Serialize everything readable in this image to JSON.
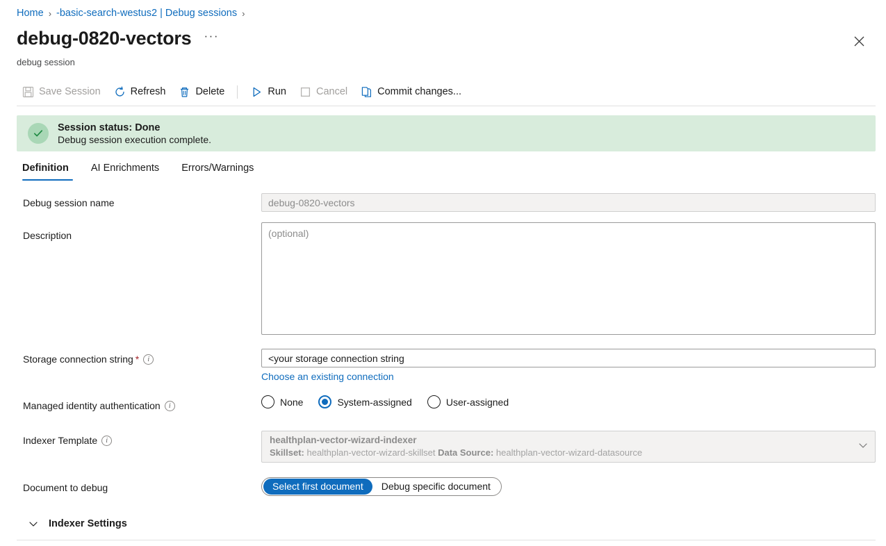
{
  "breadcrumb": {
    "items": [
      {
        "label": "Home"
      },
      {
        "label": "-basic-search-westus2 | Debug sessions"
      }
    ],
    "separator": "›"
  },
  "header": {
    "title": "debug-0820-vectors",
    "ellipsis": "···",
    "subtitle": "debug session",
    "close_icon": "close-icon"
  },
  "toolbar": {
    "items": [
      {
        "label": "Save Session",
        "icon": "save-icon",
        "disabled": true
      },
      {
        "label": "Refresh",
        "icon": "refresh-icon",
        "disabled": false
      },
      {
        "label": "Delete",
        "icon": "trash-icon",
        "disabled": false
      },
      {
        "label": "Run",
        "icon": "play-icon",
        "disabled": false
      },
      {
        "label": "Cancel",
        "icon": "stop-icon",
        "disabled": true
      },
      {
        "label": "Commit changes...",
        "icon": "copy-icon",
        "disabled": false
      }
    ]
  },
  "banner": {
    "title": "Session status: Done",
    "message": "Debug session execution complete.",
    "icon": "check-circle-icon",
    "background": "#d8ecdc",
    "icon_background": "#a9d7b6",
    "check_color": "#1f8a43"
  },
  "tabs": [
    {
      "label": "Definition",
      "active": true
    },
    {
      "label": "AI Enrichments",
      "active": false
    },
    {
      "label": "Errors/Warnings",
      "active": false
    }
  ],
  "form": {
    "session_name": {
      "label": "Debug session name",
      "value": "debug-0820-vectors",
      "disabled": true
    },
    "description": {
      "label": "Description",
      "value": "",
      "placeholder": "(optional)"
    },
    "storage_connection": {
      "label": "Storage connection string",
      "required_marker": "*",
      "value": "<your storage connection string",
      "link": "Choose an existing connection"
    },
    "managed_identity": {
      "label": "Managed identity authentication",
      "options": [
        {
          "label": "None",
          "selected": false
        },
        {
          "label": "System-assigned",
          "selected": true
        },
        {
          "label": "User-assigned",
          "selected": false
        }
      ]
    },
    "indexer_template": {
      "label": "Indexer Template",
      "value": "healthplan-vector-wizard-indexer",
      "skillset_label": "Skillset:",
      "skillset_value": "healthplan-vector-wizard-skillset",
      "datasource_label": "Data Source:",
      "datasource_value": "healthplan-vector-wizard-datasource"
    },
    "document_to_debug": {
      "label": "Document to debug",
      "options": [
        {
          "label": "Select first document",
          "selected": true
        },
        {
          "label": "Debug specific document",
          "selected": false
        }
      ]
    },
    "indexer_settings": {
      "label": "Indexer Settings",
      "expanded": false
    }
  },
  "colors": {
    "accent": "#0f6cbd",
    "required": "#a4262c",
    "text": "#1b1b1b"
  }
}
